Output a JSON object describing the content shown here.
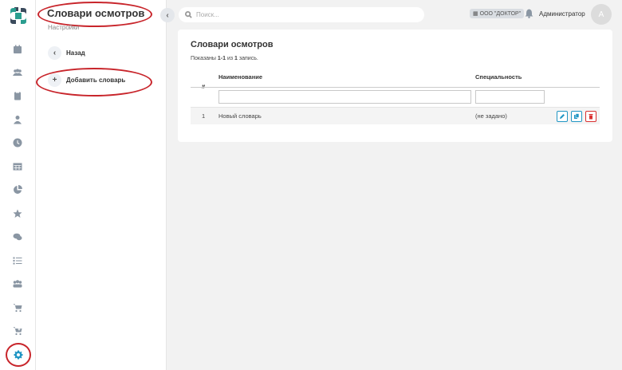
{
  "topbar": {
    "search_placeholder": "Поиск...",
    "org": "ООО \"ДОКТОР\"",
    "user": "Администратор",
    "avatar_letter": "А"
  },
  "subnav": {
    "title": "Словари осмотров",
    "subtitle": "Настройки",
    "back_label": "Назад",
    "add_label": "Добавить словарь"
  },
  "rail": {
    "icons": [
      "calendar-icon",
      "users-icon",
      "clipboard-icon",
      "user-icon",
      "clock-icon",
      "table-icon",
      "pie-chart-icon",
      "star-icon",
      "chat-icon",
      "list-icon",
      "group-icon",
      "cart-icon",
      "cart-add-icon",
      "gear-icon"
    ],
    "active": "gear-icon"
  },
  "main": {
    "title": "Словари осмотров",
    "summary": {
      "prefix": "Показаны ",
      "range": "1-1",
      "middle": " из ",
      "total": "1",
      "suffix": " запись."
    },
    "columns": {
      "num": "#",
      "name": "Наименование",
      "specialty": "Специальность"
    },
    "rows": [
      {
        "num": "1",
        "name": "Новый словарь",
        "specialty": "(не задано)"
      }
    ]
  },
  "colors": {
    "accent": "#2196c4",
    "danger": "#d93030",
    "annotation": "#c8252b"
  }
}
